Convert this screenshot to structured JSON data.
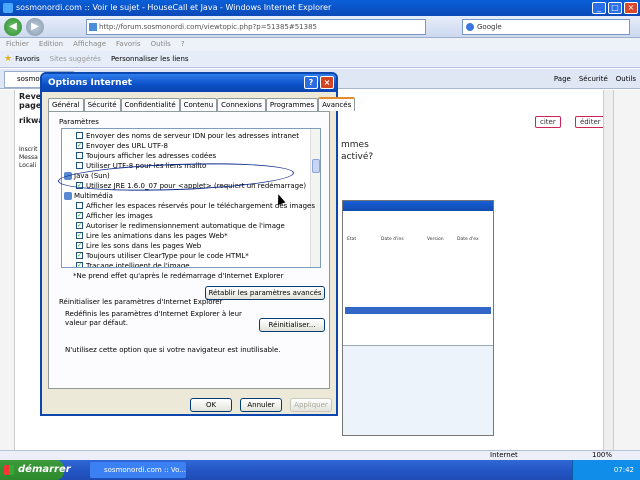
{
  "browser": {
    "window_title": "sosmonordi.com :: Voir le sujet - HouseCall et Java - Windows Internet Explorer",
    "address": "http://forum.sosmonordi.com/viewtopic.php?p=51385#51385",
    "search_engine": "Google",
    "menu": [
      "Fichier",
      "Edition",
      "Affichage",
      "Favoris",
      "Outils",
      "?"
    ],
    "favorites_label": "Favoris",
    "suggested_sites": "Sites suggérés",
    "customize_links": "Personnaliser les liens",
    "tab_label": "sosmonordi",
    "command_bar": [
      "Page",
      "Sécurité",
      "Outils"
    ]
  },
  "page": {
    "text_rev": "Rever",
    "text_page": "page",
    "text_rikwa": "rikwa",
    "text_inscrit": "Inscrit",
    "text_mess": "Messa",
    "text_local": "Locali",
    "text_mmes": "mmes",
    "text_active": "activé?",
    "quote_button": "citer",
    "edit_button": "éditer",
    "embed_rows": [
      "Etat",
      "Date d'ins",
      "Version",
      "Date d'ex"
    ]
  },
  "dialog": {
    "title": "Options Internet",
    "help": "?",
    "close": "×",
    "tabs": [
      "Général",
      "Sécurité",
      "Confidentialité",
      "Contenu",
      "Connexions",
      "Programmes",
      "Avancés"
    ],
    "active_tab": "Avancés",
    "settings_group": "Paramètres",
    "items": [
      {
        "text": "Envoyer des noms de serveur IDN pour les adresses intranet",
        "checked": false,
        "group": false
      },
      {
        "text": "Envoyer des URL UTF-8",
        "checked": true,
        "group": false
      },
      {
        "text": "Toujours afficher les adresses codées",
        "checked": false,
        "group": false
      },
      {
        "text": "Utiliser UTF-8 pour les liens mailto",
        "checked": false,
        "group": false
      },
      {
        "text": "Java (Sun)",
        "checked": false,
        "group": true
      },
      {
        "text": "Utilisez JRE 1.6.0_07 pour <applet> (requiert un redémarrage)",
        "checked": true,
        "group": false
      },
      {
        "text": "Multimédia",
        "checked": false,
        "group": true
      },
      {
        "text": "Afficher les espaces réservés pour le téléchargement des images",
        "checked": false,
        "group": false
      },
      {
        "text": "Afficher les images",
        "checked": true,
        "group": false
      },
      {
        "text": "Autoriser le redimensionnement automatique de l'image",
        "checked": true,
        "group": false
      },
      {
        "text": "Lire les animations dans les pages Web*",
        "checked": true,
        "group": false
      },
      {
        "text": "Lire les sons dans les pages Web",
        "checked": true,
        "group": false
      },
      {
        "text": "Toujours utiliser ClearType pour le code HTML*",
        "checked": true,
        "group": false
      },
      {
        "text": "Traçage intelligent de l'image",
        "checked": true,
        "group": false
      }
    ],
    "restart_note": "*Ne prend effet qu'après le redémarrage d'Internet Explorer",
    "restore_button": "Rétablir les paramètres avancés",
    "reset_section": "Réinitialiser les paramètres d'Internet Explorer",
    "reset_desc": "Redéfinis les paramètres d'Internet Explorer à leur valeur par défaut.",
    "reset_button": "Réinitialiser...",
    "hint": "N'utilisez cette option que si votre navigateur est inutilisable.",
    "ok": "OK",
    "cancel": "Annuler",
    "apply": "Appliquer"
  },
  "statusbar": {
    "zone": "Internet",
    "zoom": "100%"
  },
  "taskbar": {
    "start": "démarrer",
    "task": "sosmonordi.com :: Vo...",
    "clock": "07:42"
  }
}
